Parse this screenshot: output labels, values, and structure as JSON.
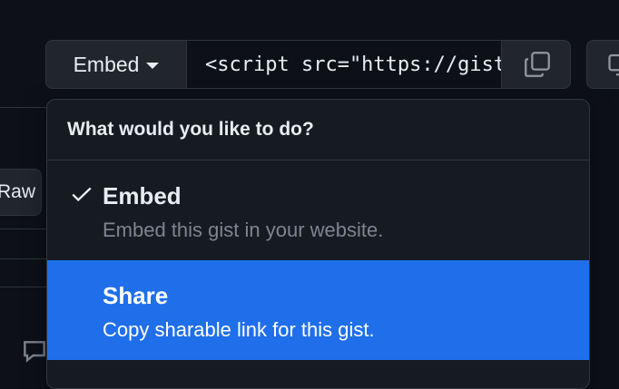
{
  "toolbar": {
    "embed_label": "Embed",
    "embed_code": "<script src=\"https://gist.github.com/",
    "raw_label": "Raw"
  },
  "menu": {
    "header": "What would you like to do?",
    "items": [
      {
        "title": "Embed",
        "description": "Embed this gist in your website.",
        "selected": true
      },
      {
        "title": "Share",
        "description": "Copy sharable link for this gist.",
        "highlighted": true
      }
    ]
  },
  "colors": {
    "accent": "#1f6feb",
    "background": "#0d1117",
    "surface": "#161b22"
  },
  "icons": [
    "chevron-down-icon",
    "copy-icon",
    "desktop-icon",
    "check-icon",
    "comment-icon"
  ]
}
